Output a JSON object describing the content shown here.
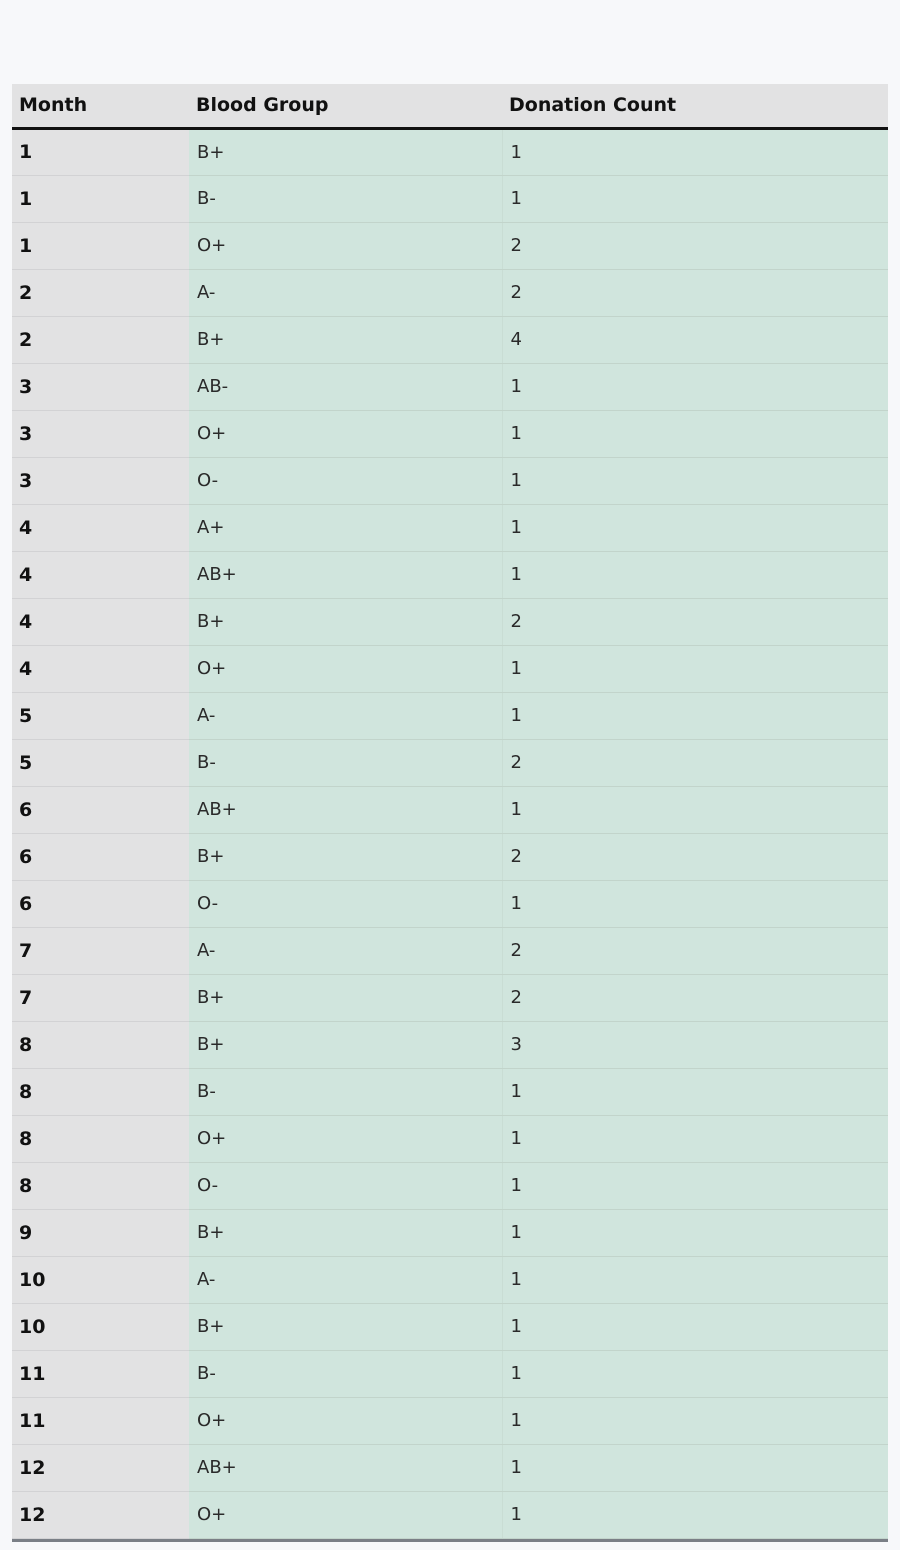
{
  "table": {
    "headers": [
      "Month",
      "Blood Group",
      "Donation Count"
    ],
    "rows": [
      [
        "1",
        "B+",
        "1"
      ],
      [
        "1",
        "B-",
        "1"
      ],
      [
        "1",
        "O+",
        "2"
      ],
      [
        "2",
        "A-",
        "2"
      ],
      [
        "2",
        "B+",
        "4"
      ],
      [
        "3",
        "AB-",
        "1"
      ],
      [
        "3",
        "O+",
        "1"
      ],
      [
        "3",
        "O-",
        "1"
      ],
      [
        "4",
        "A+",
        "1"
      ],
      [
        "4",
        "AB+",
        "1"
      ],
      [
        "4",
        "B+",
        "2"
      ],
      [
        "4",
        "O+",
        "1"
      ],
      [
        "5",
        "A-",
        "1"
      ],
      [
        "5",
        "B-",
        "2"
      ],
      [
        "6",
        "AB+",
        "1"
      ],
      [
        "6",
        "B+",
        "2"
      ],
      [
        "6",
        "O-",
        "1"
      ],
      [
        "7",
        "A-",
        "2"
      ],
      [
        "7",
        "B+",
        "2"
      ],
      [
        "8",
        "B+",
        "3"
      ],
      [
        "8",
        "B-",
        "1"
      ],
      [
        "8",
        "O+",
        "1"
      ],
      [
        "8",
        "O-",
        "1"
      ],
      [
        "9",
        "B+",
        "1"
      ],
      [
        "10",
        "A-",
        "1"
      ],
      [
        "10",
        "B+",
        "1"
      ],
      [
        "11",
        "B-",
        "1"
      ],
      [
        "11",
        "O+",
        "1"
      ],
      [
        "12",
        "AB+",
        "1"
      ],
      [
        "12",
        "O+",
        "1"
      ]
    ]
  },
  "colors": {
    "page_background": "#f7f8fa",
    "header_background": "#e2e2e3",
    "month_column_background": "#e2e2e3",
    "data_cell_background": "#d0e5dd"
  }
}
